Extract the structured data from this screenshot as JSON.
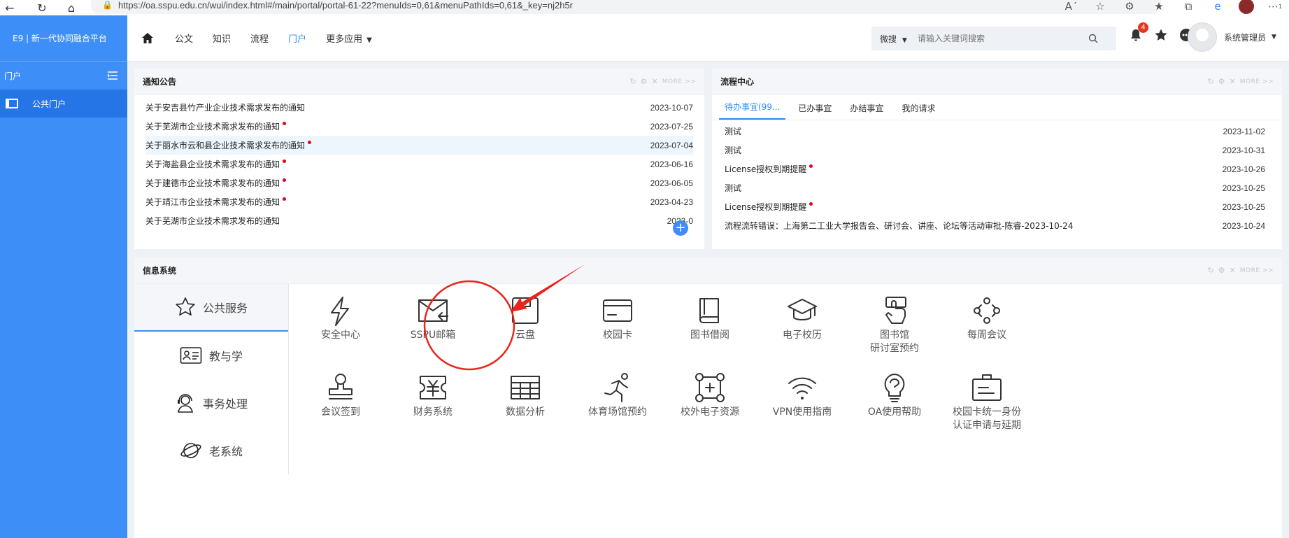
{
  "browser": {
    "url": "https://oa.sspu.edu.cn/wui/index.html#/main/portal/portal-61-22?menuIds=0,61&menuPathIds=0,61&_key=nj2h5r",
    "profile_badge": "1"
  },
  "sidebar": {
    "brand": "E9 | 新一代协同融合平台",
    "section_title": "门户",
    "items": [
      {
        "label": "公共门户"
      }
    ]
  },
  "topnav": {
    "items": [
      "公文",
      "知识",
      "流程",
      "门户",
      "更多应用"
    ],
    "active": "门户",
    "search_scope": "微搜",
    "search_placeholder": "请输入关键词搜索",
    "notification_count": "4",
    "username": "系统管理员"
  },
  "notice_panel": {
    "title": "通知公告",
    "more_label": "MORE >>",
    "rows": [
      {
        "title": "关于安吉县竹产业企业技术需求发布的通知",
        "date": "2023-10-07",
        "new": false
      },
      {
        "title": "关于芜湖市企业技术需求发布的通知",
        "date": "2023-07-25",
        "new": true
      },
      {
        "title": "关于丽水市云和县企业技术需求发布的通知",
        "date": "2023-07-04",
        "new": true
      },
      {
        "title": "关于海盐县企业技术需求发布的通知",
        "date": "2023-06-16",
        "new": true
      },
      {
        "title": "关于建德市企业技术需求发布的通知",
        "date": "2023-06-05",
        "new": true
      },
      {
        "title": "关于靖江市企业技术需求发布的通知",
        "date": "2023-04-23",
        "new": true
      },
      {
        "title": "关于芜湖市企业技术需求发布的通知",
        "date": "2023-0",
        "new": false
      }
    ]
  },
  "workflow_panel": {
    "title": "流程中心",
    "more_label": "MORE >>",
    "tabs": [
      "待办事宜(99...",
      "已办事宜",
      "办结事宜",
      "我的请求"
    ],
    "rows": [
      {
        "title": "测试",
        "date": "2023-11-02",
        "new": false
      },
      {
        "title": "测试",
        "date": "2023-10-31",
        "new": false
      },
      {
        "title": "License授权到期提醒",
        "date": "2023-10-26",
        "new": true
      },
      {
        "title": "测试",
        "date": "2023-10-25",
        "new": false
      },
      {
        "title": "License授权到期提醒",
        "date": "2023-10-25",
        "new": true
      },
      {
        "title": "流程流转错误：上海第二工业大学报告会、研讨会、讲座、论坛等活动审批-陈睿-2023-10-24",
        "date": "2023-10-24",
        "new": false
      }
    ]
  },
  "info_panel": {
    "title": "信息系统",
    "more_label": "MORE >>",
    "categories": [
      "公共服务",
      "教与学",
      "事务处理",
      "老系统"
    ],
    "apps": [
      {
        "label": "安全中心",
        "icon": "lightning-icon"
      },
      {
        "label": "SSPU邮箱",
        "icon": "mail-icon"
      },
      {
        "label": "云盘",
        "icon": "disk-icon"
      },
      {
        "label": "校园卡",
        "icon": "card-icon"
      },
      {
        "label": "图书借阅",
        "icon": "book-icon"
      },
      {
        "label": "电子校历",
        "icon": "graduation-cap-icon"
      },
      {
        "label": "图书馆\n研讨室预约",
        "icon": "hand-ticket-icon"
      },
      {
        "label": "每周会议",
        "icon": "meeting-icon"
      },
      {
        "label": "会议签到",
        "icon": "stamp-icon"
      },
      {
        "label": "财务系统",
        "icon": "finance-icon"
      },
      {
        "label": "数据分析",
        "icon": "table-icon"
      },
      {
        "label": "体育场馆预约",
        "icon": "runner-icon"
      },
      {
        "label": "校外电子资源",
        "icon": "network-icon"
      },
      {
        "label": "VPN使用指南",
        "icon": "wifi-icon"
      },
      {
        "label": "OA使用帮助",
        "icon": "help-bulb-icon"
      },
      {
        "label": "校园卡统一身份\n认证申请与延期",
        "icon": "id-badge-icon"
      }
    ]
  },
  "colors": {
    "sidebar": "#3e8ef7",
    "accent": "#2d8cf0",
    "annotation": "#e8251c"
  }
}
